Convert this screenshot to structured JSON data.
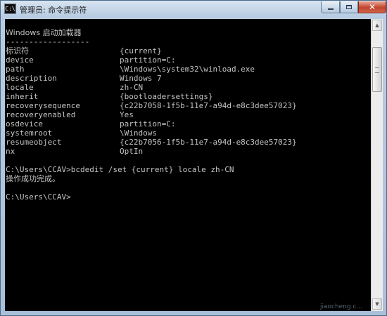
{
  "window": {
    "icon_text": "C:\\",
    "title": "管理员: 命令提示符"
  },
  "console": {
    "heading": "Windows 启动加载器",
    "underline": "------------------",
    "entries": [
      {
        "key": "标识符",
        "value": "{current}"
      },
      {
        "key": "device",
        "value": "partition=C:"
      },
      {
        "key": "path",
        "value": "\\Windows\\system32\\winload.exe"
      },
      {
        "key": "description",
        "value": "Windows 7"
      },
      {
        "key": "locale",
        "value": "zh-CN"
      },
      {
        "key": "inherit",
        "value": "{bootloadersettings}"
      },
      {
        "key": "recoverysequence",
        "value": "{c22b7058-1f5b-11e7-a94d-e8c3dee57023}"
      },
      {
        "key": "recoveryenabled",
        "value": "Yes"
      },
      {
        "key": "osdevice",
        "value": "partition=C:"
      },
      {
        "key": "systemroot",
        "value": "\\Windows"
      },
      {
        "key": "resumeobject",
        "value": "{c22b7056-1f5b-11e7-a94d-e8c3dee57023}"
      },
      {
        "key": "nx",
        "value": "OptIn"
      }
    ],
    "command": "C:\\Users\\CCAV>bcdedit /set {current} locale zh-CN",
    "result": "操作成功完成。",
    "prompt": "C:\\Users\\CCAV>"
  },
  "watermark": "jiaocheng.c..."
}
